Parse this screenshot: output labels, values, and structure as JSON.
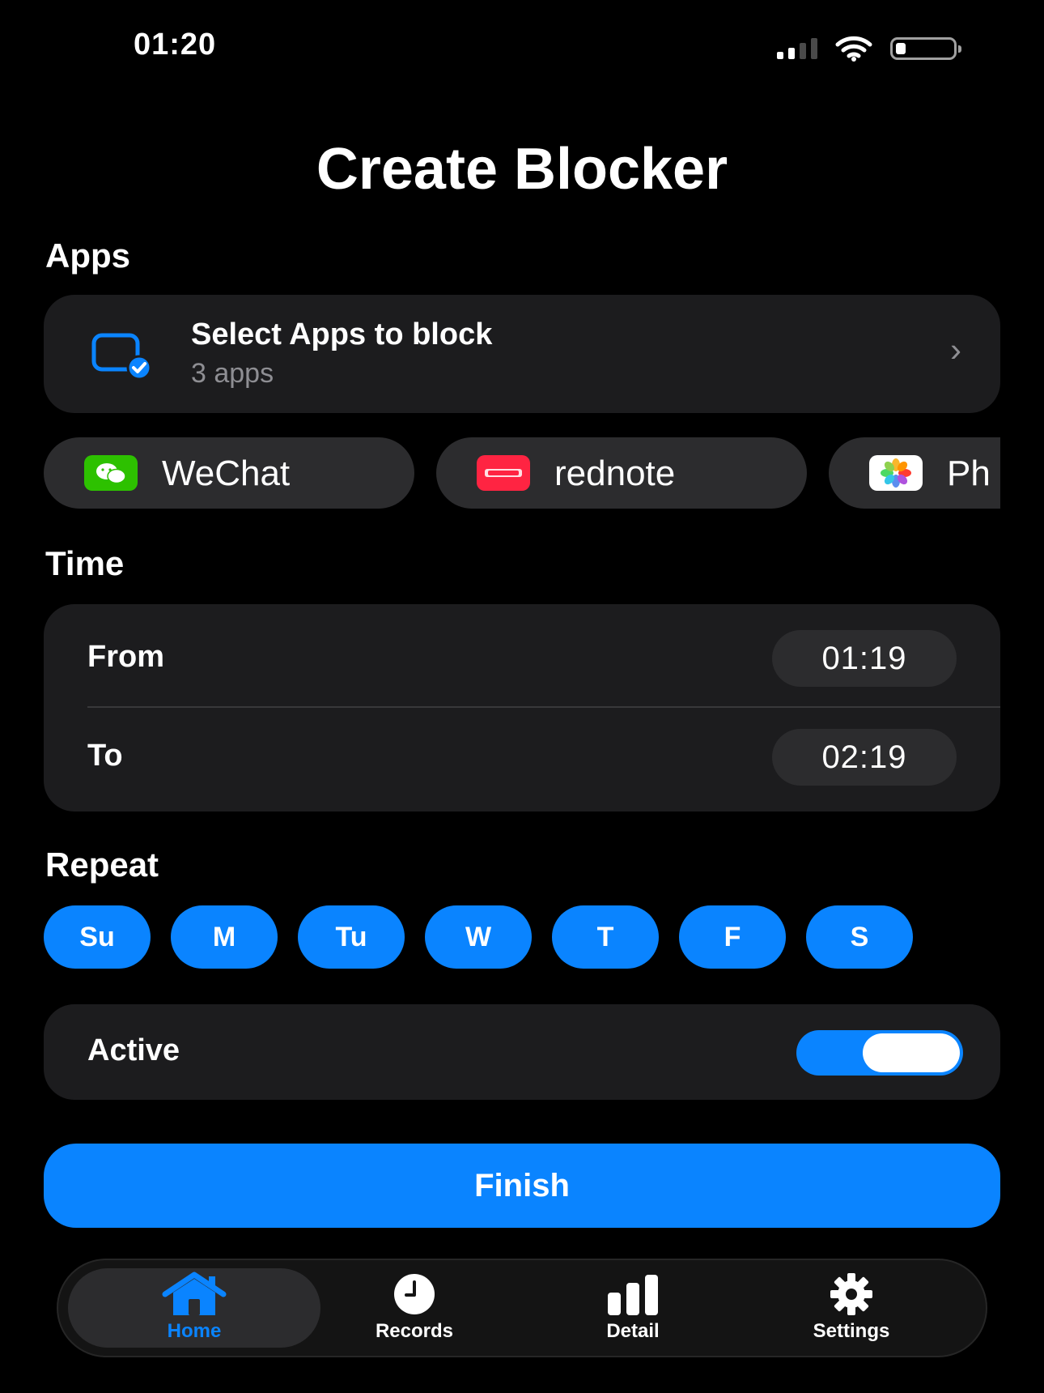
{
  "status_bar": {
    "time": "01:20"
  },
  "page_title": "Create Blocker",
  "apps_section": {
    "label": "Apps",
    "select_title": "Select Apps to block",
    "select_subtitle": "3 apps",
    "chips": [
      {
        "label": "WeChat",
        "icon": "wechat-icon"
      },
      {
        "label": "rednote",
        "icon": "rednote-icon"
      },
      {
        "label": "Ph",
        "icon": "photos-icon"
      }
    ]
  },
  "time_section": {
    "label": "Time",
    "from_label": "From",
    "from_value": "01:19",
    "to_label": "To",
    "to_value": "02:19"
  },
  "repeat_section": {
    "label": "Repeat",
    "days": [
      {
        "label": "Su",
        "selected": true
      },
      {
        "label": "M",
        "selected": true
      },
      {
        "label": "Tu",
        "selected": true
      },
      {
        "label": "W",
        "selected": true
      },
      {
        "label": "T",
        "selected": true
      },
      {
        "label": "F",
        "selected": true
      },
      {
        "label": "S",
        "selected": true
      }
    ]
  },
  "active_row": {
    "label": "Active",
    "enabled": true
  },
  "finish_label": "Finish",
  "tab_bar": {
    "tabs": [
      {
        "label": "Home",
        "icon": "house-icon",
        "active": true
      },
      {
        "label": "Records",
        "icon": "clock-icon",
        "active": false
      },
      {
        "label": "Detail",
        "icon": "bar-chart-icon",
        "active": false
      },
      {
        "label": "Settings",
        "icon": "gear-icon",
        "active": false
      }
    ]
  },
  "colors": {
    "accent": "#0a84ff",
    "card": "#1c1c1e",
    "chip": "#2c2c2e",
    "secondary_text": "#8e8e93"
  }
}
